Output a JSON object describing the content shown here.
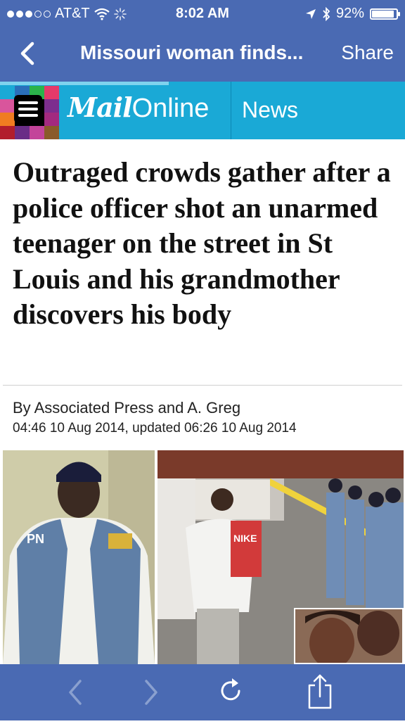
{
  "status_bar": {
    "carrier": "AT&T",
    "time": "8:02 AM",
    "battery": "92%",
    "battery_level": 0.92,
    "signal_bars_filled": 3,
    "signal_bars_total": 5
  },
  "nav": {
    "back_icon": "chevron-left-icon",
    "title": "Missouri woman finds...",
    "share_label": "Share"
  },
  "site_header": {
    "logo_mail": "Mail",
    "logo_online": "Online",
    "section": "News",
    "menu_icon": "menu-icon",
    "colors": {
      "bar": "#1aa9d6",
      "nav": "#4a6ab3"
    }
  },
  "article": {
    "headline": "Outraged crowds gather after a police officer shot an unarmed teenager on the street in St Louis and his grandmother discovers his body",
    "byline": "By Associated Press and A. Greg",
    "dateline": "04:46 10 Aug 2014, updated 06:26 10 Aug 2014",
    "images": [
      {
        "name": "portrait-photo",
        "vest_text": "PN"
      },
      {
        "name": "crowd-photo",
        "shirt_text": "NIKE"
      },
      {
        "name": "inset-photo"
      }
    ]
  },
  "toolbar": {
    "back_icon": "chevron-left-icon",
    "forward_icon": "chevron-right-icon",
    "reload_icon": "reload-icon",
    "share_icon": "share-icon"
  }
}
